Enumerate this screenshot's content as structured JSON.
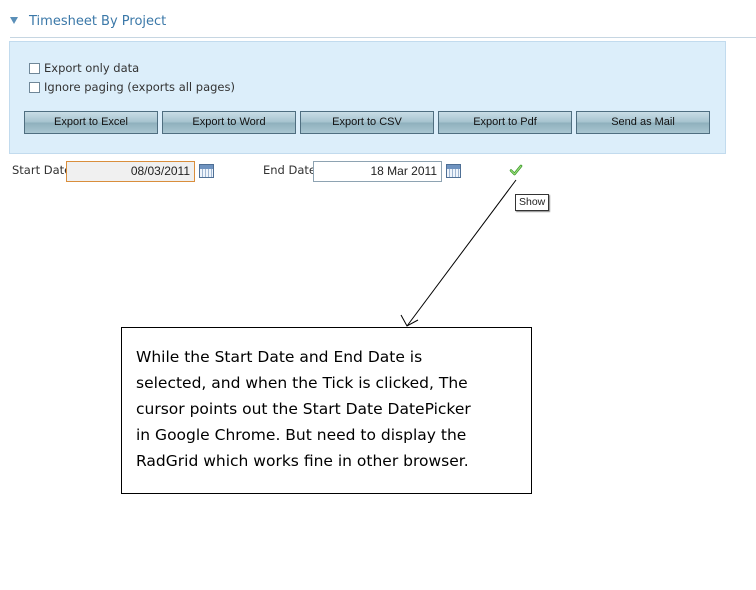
{
  "header": {
    "title": "Timesheet By Project"
  },
  "export": {
    "checkboxes": [
      {
        "label": "Export only data",
        "checked": false
      },
      {
        "label": "Ignore paging (exports all pages)",
        "checked": false
      }
    ],
    "buttons": [
      "Export to Excel",
      "Export to Word",
      "Export to CSV",
      "Export to Pdf",
      "Send as Mail"
    ]
  },
  "filters": {
    "start_label": "Start Date",
    "start_value": "08/03/2011",
    "end_label": "End Date",
    "end_value": "18 Mar 2011",
    "show_tooltip": "Show"
  },
  "annotation": {
    "lines": [
      "While the Start Date and End Date is",
      "selected, and when the Tick is clicked, The",
      "cursor points out the Start Date DatePicker",
      "in Google Chrome. But need to display the",
      "RadGrid which works fine in other browser."
    ]
  },
  "colors": {
    "title": "#3b78a8",
    "panel": "#dceefa",
    "focus_border": "#d98e3c"
  }
}
